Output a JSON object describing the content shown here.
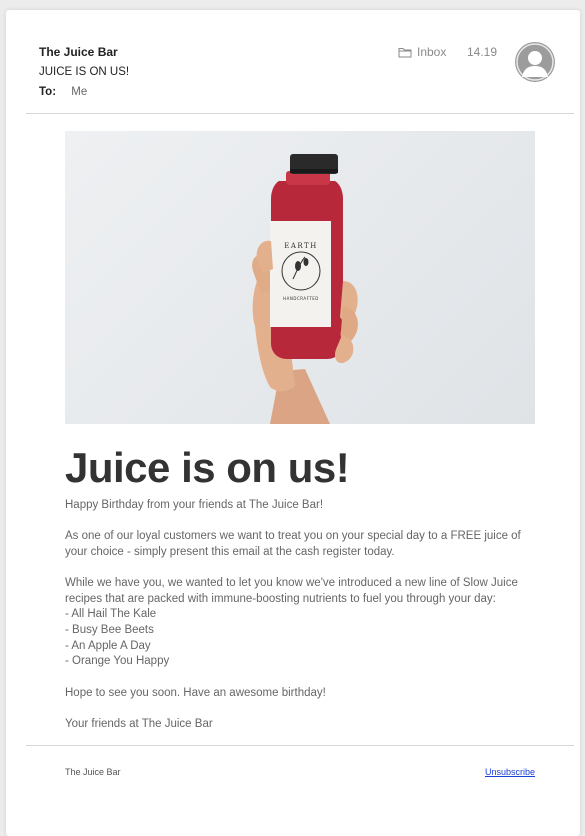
{
  "email": {
    "sender": "The Juice Bar",
    "subject": "JUICE IS ON US!",
    "to_label": "To:",
    "to_value": "Me",
    "folder": "Inbox",
    "time": "14.19",
    "icons": {
      "folder": "folder-icon",
      "avatar": "avatar-placeholder-icon"
    }
  },
  "hero": {
    "brand_text": "EARTH",
    "label_subtext": "HANDCRAFTED",
    "colors": {
      "juice": "#b8283b",
      "cap": "#2a2a2a",
      "label": "#f4f2ee",
      "skin": "#e3b08d"
    }
  },
  "content": {
    "headline": "Juice is on us!",
    "greeting": "Happy Birthday from your friends at The Juice Bar!",
    "offer": "As one of our loyal customers we want to treat you on your special day to a FREE juice of your choice - simply present this email at the cash register today.",
    "intro": "While we have you, we wanted to let you know we've introduced a new line of Slow Juice recipes that are packed with immune-boosting nutrients to fuel you through your day:",
    "items": [
      "- All Hail The Kale",
      "- Busy Bee Beets",
      "- An Apple A Day",
      "- Orange You Happy"
    ],
    "closing": "Hope to see you soon. Have an awesome birthday!",
    "signoff": "Your friends at The Juice Bar"
  },
  "footer": {
    "company": "The Juice Bar",
    "unsubscribe": "Unsubscribe"
  }
}
